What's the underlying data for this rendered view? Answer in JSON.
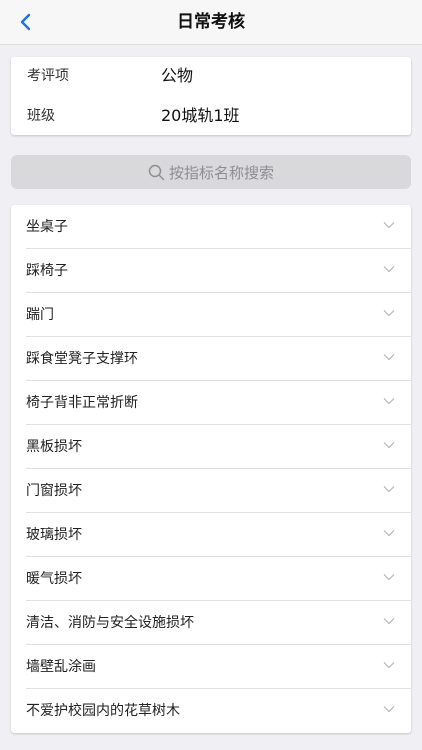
{
  "navbar": {
    "title": "日常考核",
    "back_icon": "chevron-left-icon"
  },
  "info": [
    {
      "key": "考评项",
      "value": "公物"
    },
    {
      "key": "班级",
      "value": "20城轨1班"
    }
  ],
  "search": {
    "placeholder": "按指标名称搜索",
    "icon": "search-icon"
  },
  "items": [
    {
      "label": "坐桌子"
    },
    {
      "label": "踩椅子"
    },
    {
      "label": "踹门"
    },
    {
      "label": "踩食堂凳子支撑环"
    },
    {
      "label": "椅子背非正常折断"
    },
    {
      "label": "黑板损坏"
    },
    {
      "label": "门窗损坏"
    },
    {
      "label": "玻璃损坏"
    },
    {
      "label": "暖气损坏"
    },
    {
      "label": "清洁、消防与安全设施损坏"
    },
    {
      "label": "墙壁乱涂画"
    },
    {
      "label": "不爱护校园内的花草树木"
    }
  ],
  "colors": {
    "accent": "#1a73e8",
    "background": "#efeff4"
  }
}
